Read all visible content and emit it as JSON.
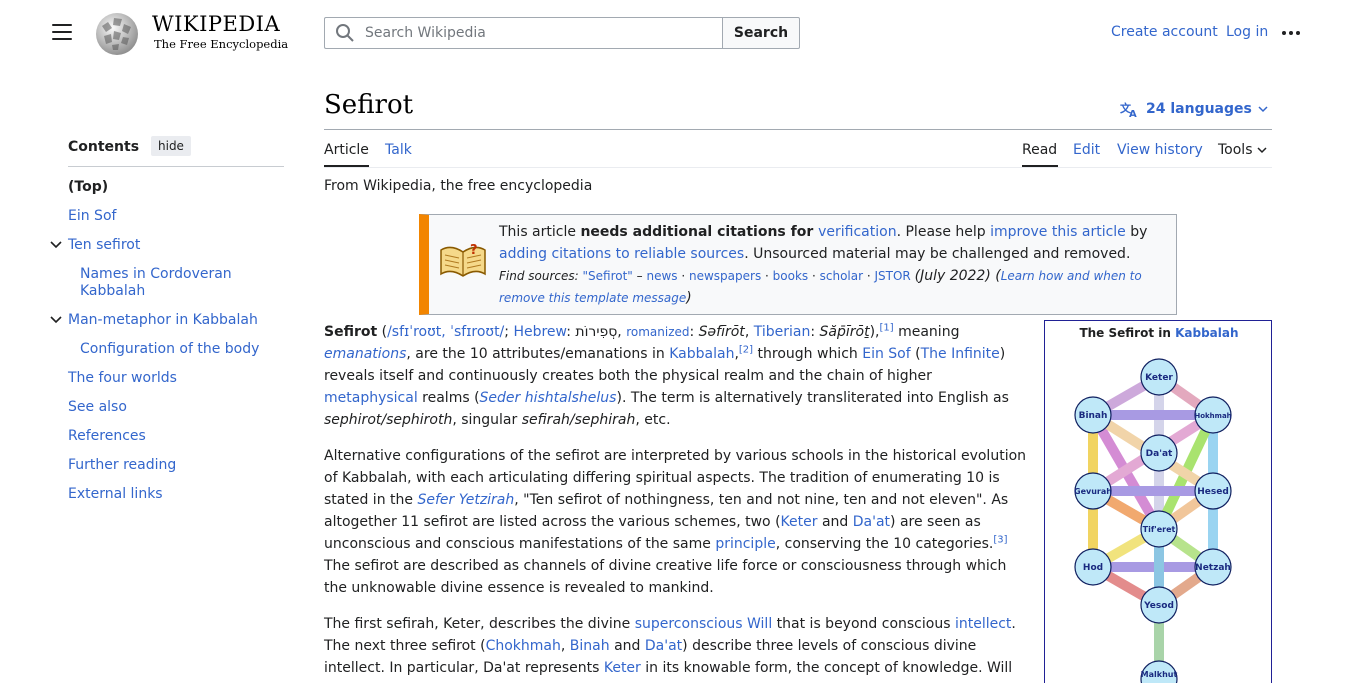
{
  "header": {
    "wordmark": "WIKIPEDIA",
    "tagline": "The Free Encyclopedia",
    "search_placeholder": "Search Wikipedia",
    "search_button": "Search",
    "create_account": "Create account",
    "login": "Log in"
  },
  "toc": {
    "title": "Contents",
    "hide": "hide",
    "items": [
      "(Top)",
      "Ein Sof",
      "Ten sefirot",
      "Names in Cordoveran Kabbalah",
      "Man-metaphor in Kabbalah",
      "Configuration of the body",
      "The four worlds",
      "See also",
      "References",
      "Further reading",
      "External links"
    ]
  },
  "article": {
    "title": "Sefirot",
    "languages": "24 languages",
    "tabs": {
      "article": "Article",
      "talk": "Talk",
      "read": "Read",
      "edit": "Edit",
      "history": "View history",
      "tools": "Tools"
    },
    "from": "From Wikipedia, the free encyclopedia"
  },
  "ambox": {
    "t1": "This article ",
    "t2": "needs additional citations for ",
    "t3": "verification",
    "t4": ". Please help ",
    "t5": "improve this article",
    "t6": " by ",
    "t7": "adding citations to reliable sources",
    "t8": ". Unsourced material may be challenged and removed.",
    "find": "Find sources: ",
    "q": "\"Sefirot\"",
    "dash": " – ",
    "news": "news",
    "newspapers": "newspapers",
    "books": "books",
    "scholar": "scholar",
    "jstor": "JSTOR",
    "date": " (July 2022) (",
    "learn": "Learn how and when to remove this template message",
    "close": ")"
  },
  "p1": {
    "a": "Sefirot",
    "b": " (",
    "c": "/sfɪˈroʊt, ˈsfɪroʊt/",
    "d": "; ",
    "e": "Hebrew",
    "f": ": סְפִירוֹת, ",
    "g": "romanized",
    "h": ": ",
    "i": "Səfīrōt",
    "j": ", ",
    "k": "Tiberian",
    "l": ": ",
    "m": "Săp̄īrōṯ",
    "n": "),",
    "o": "[1]",
    "p": " meaning ",
    "q": "emanations",
    "r": ", are the 10 attributes/emanations in ",
    "s": "Kabbalah",
    "t": ",",
    "u": "[2]",
    "v": " through which ",
    "w": "Ein Sof",
    "x": " (",
    "y": "The Infinite",
    "z": ") reveals itself and continuously creates both the physical realm and the chain of higher ",
    "aa": "metaphysical",
    "ab": " realms (",
    "ac": "Seder hishtalshelus",
    "ad": "). The term is alternatively transliterated into English as ",
    "ae": "sephirot/sephiroth",
    "af": ", singular ",
    "ag": "sefirah/sephirah",
    "ah": ", etc."
  },
  "p2": {
    "a": "Alternative configurations of the sefirot are interpreted by various schools in the historical evolution of Kabbalah, with each articulating differing spiritual aspects. The tradition of enumerating 10 is stated in the ",
    "b": "Sefer Yetzirah",
    "c": ", \"Ten sefirot of nothingness, ten and not nine, ten and not eleven\". As altogether 11 sefirot are listed across the various schemes, two (",
    "d": "Keter",
    "e": " and ",
    "f": "Da'at",
    "g": ") are seen as unconscious and conscious manifestations of the same ",
    "h": "principle",
    "i": ", conserving the 10 categories.",
    "j": "[3]",
    "k": " The sefirot are described as channels of divine creative life force or consciousness through which the unknowable divine essence is revealed to mankind."
  },
  "p3": {
    "a": "The first sefirah, Keter, describes the divine ",
    "b": "superconscious Will",
    "c": " that is beyond conscious ",
    "d": "intellect",
    "e": ". The next three sefirot (",
    "f": "Chokhmah",
    "g": ", ",
    "h": "Binah",
    "i": " and ",
    "j": "Da'at",
    "k": ") describe three levels of conscious divine intellect. In particular, Da'at represents ",
    "l": "Keter",
    "m": " in its knowable form, the concept of knowledge. Will"
  },
  "infobox": {
    "title_a": "The Sefirot in ",
    "title_b": "Kabbalah",
    "nodes": [
      "Keter",
      "Binah",
      "Hokhmah",
      "Da'at",
      "Gevurah",
      "Hesed",
      "Tif'eret",
      "Hod",
      "Netzah",
      "Yesod",
      "Malkhut"
    ]
  }
}
